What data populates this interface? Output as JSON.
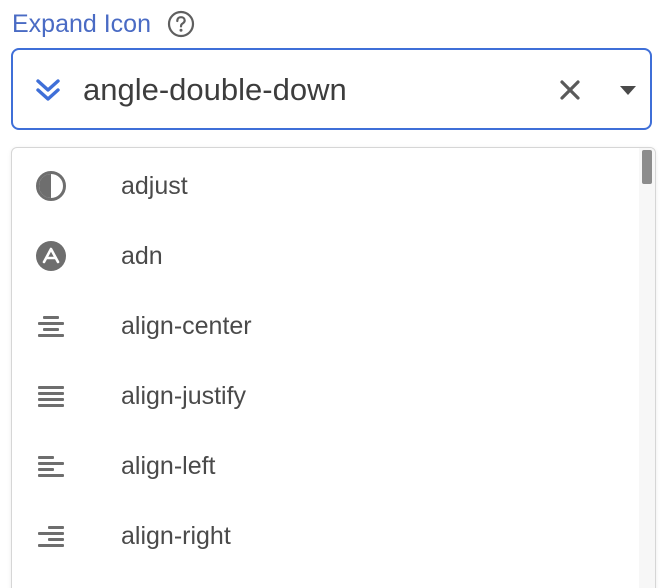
{
  "field": {
    "label": "Expand Icon",
    "help_icon": "question-circle-icon"
  },
  "select": {
    "selected_icon": "angle-double-down-icon",
    "value": "angle-double-down",
    "clear_icon": "close-icon",
    "caret_icon": "caret-down-icon"
  },
  "dropdown": {
    "options": [
      {
        "icon": "adjust-icon",
        "label": "adjust"
      },
      {
        "icon": "adn-icon",
        "label": "adn"
      },
      {
        "icon": "align-center-icon",
        "label": "align-center"
      },
      {
        "icon": "align-justify-icon",
        "label": "align-justify"
      },
      {
        "icon": "align-left-icon",
        "label": "align-left"
      },
      {
        "icon": "align-right-icon",
        "label": "align-right"
      }
    ]
  },
  "colors": {
    "label": "#4a6bc4",
    "focus_border": "#3f6fd8",
    "icon_grey": "#6e6e6e",
    "text": "#3d3d3d"
  }
}
